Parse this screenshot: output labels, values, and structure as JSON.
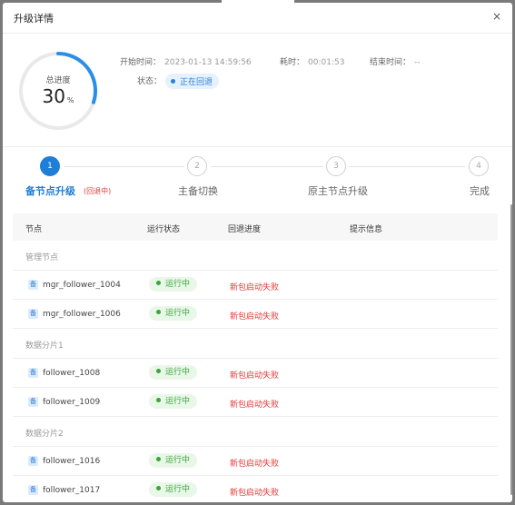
{
  "dialog": {
    "title": "升级详情",
    "close_glyph": "×"
  },
  "progress": {
    "label": "总进度",
    "value": "30",
    "unit": "%",
    "percent": 30,
    "color": "#2b8ee8",
    "track_color": "#e9e9e9"
  },
  "info": {
    "start_label": "开始时间：",
    "start_value": "2023-01-13 14:59:56",
    "elapsed_label": "耗时：",
    "elapsed_value": "00:01:53",
    "end_label": "结束时间：",
    "end_value": "--",
    "status_label": "状态：",
    "status_value": "正在回退"
  },
  "steps": [
    {
      "num": "1",
      "label": "备节点升级",
      "sub": "(回退中)",
      "active": true
    },
    {
      "num": "2",
      "label": "主备切换",
      "active": false
    },
    {
      "num": "3",
      "label": "原主节点升级",
      "active": false
    },
    {
      "num": "4",
      "label": "完成",
      "active": false
    }
  ],
  "table": {
    "columns": [
      "节点",
      "运行状态",
      "回退进度",
      "提示信息"
    ],
    "node_icon_glyph": "备",
    "groups": [
      {
        "name": "管理节点",
        "rows": [
          {
            "node": "mgr_follower_1004",
            "status": "运行中",
            "progress": "新包启动失败",
            "hint": ""
          },
          {
            "node": "mgr_follower_1006",
            "status": "运行中",
            "progress": "新包启动失败",
            "hint": ""
          }
        ]
      },
      {
        "name": "数据分片1",
        "rows": [
          {
            "node": "follower_1008",
            "status": "运行中",
            "progress": "新包启动失败",
            "hint": ""
          },
          {
            "node": "follower_1009",
            "status": "运行中",
            "progress": "新包启动失败",
            "hint": ""
          }
        ]
      },
      {
        "name": "数据分片2",
        "rows": [
          {
            "node": "follower_1016",
            "status": "运行中",
            "progress": "新包启动失败",
            "hint": ""
          },
          {
            "node": "follower_1017",
            "status": "运行中",
            "progress": "新包启动失败",
            "hint": ""
          }
        ]
      }
    ]
  },
  "colors": {
    "accent": "#1f7ed6",
    "running_green": "#3aa53a",
    "error_red": "#e23a3a"
  }
}
